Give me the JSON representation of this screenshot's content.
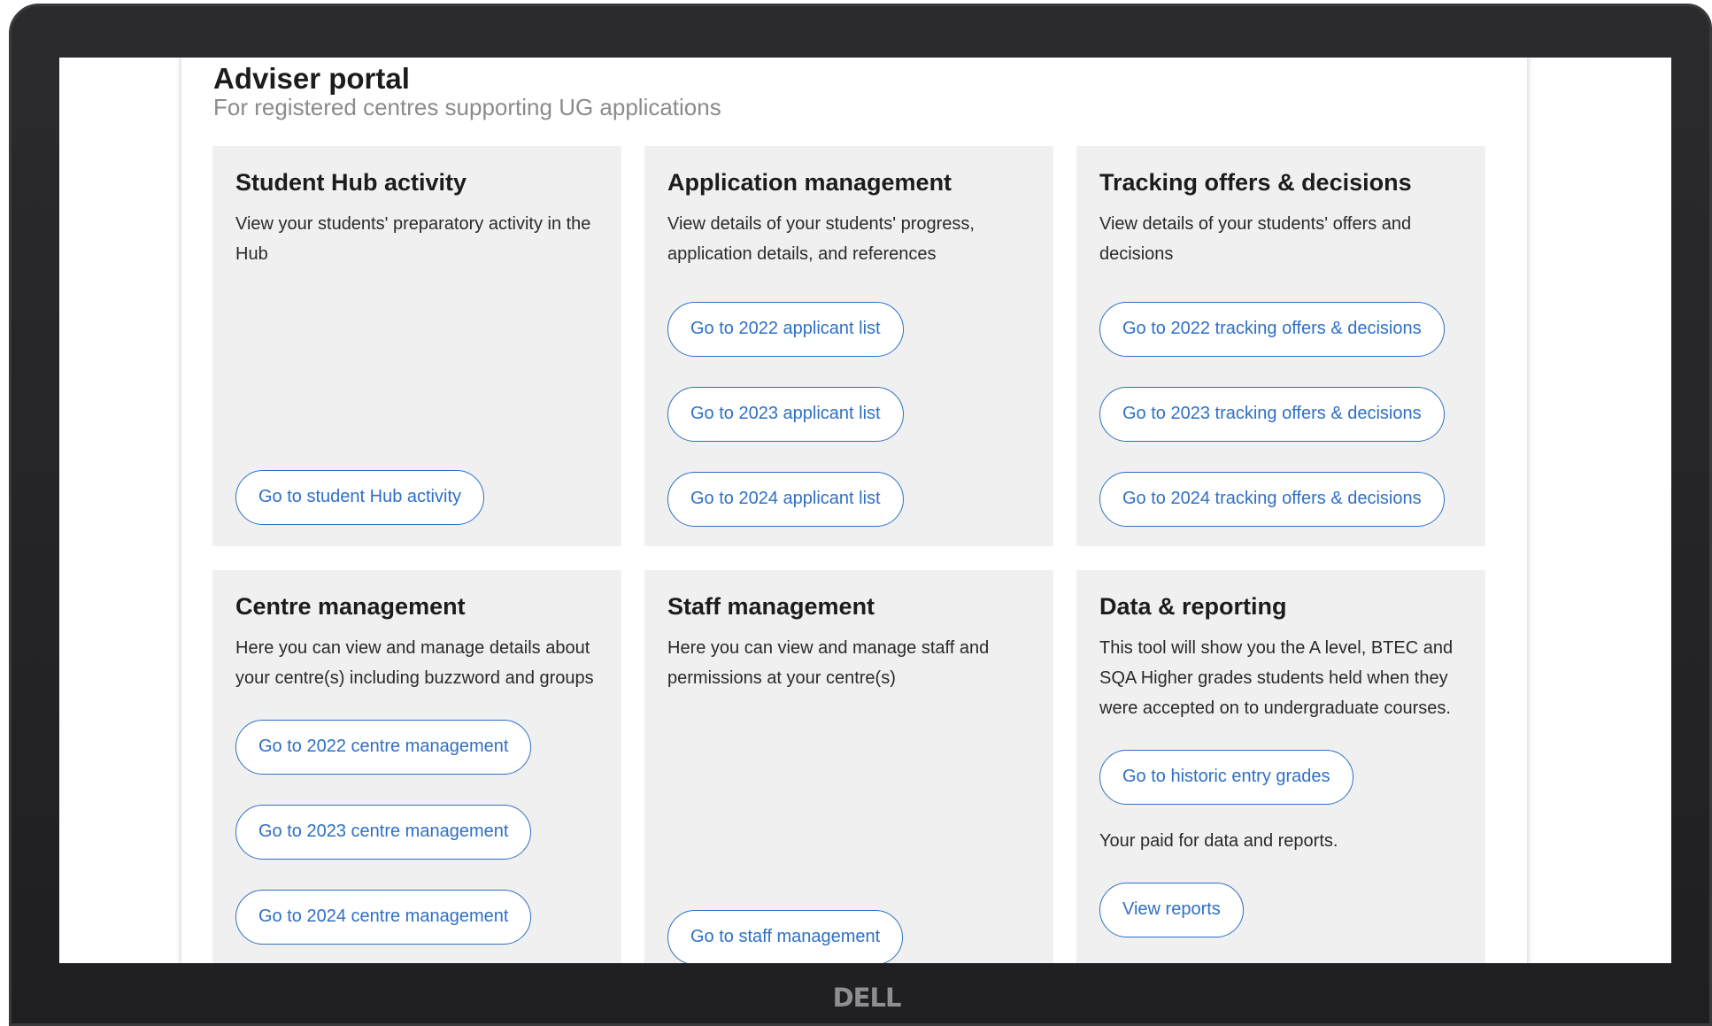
{
  "device": {
    "brand": "DELL"
  },
  "header": {
    "title": "Adviser portal",
    "subtitle": "For registered centres supporting UG applications"
  },
  "cards": [
    {
      "title": "Student Hub activity",
      "description": "View your students' preparatory activity in the Hub",
      "buttons": [
        "Go to student Hub activity"
      ]
    },
    {
      "title": "Application management",
      "description": "View details of your students' progress, application details, and references",
      "buttons": [
        "Go to 2022 applicant list",
        "Go to 2023 applicant list",
        "Go to 2024 applicant list"
      ]
    },
    {
      "title": "Tracking offers & decisions",
      "description": "View details of your students' offers and decisions",
      "buttons": [
        "Go to 2022 tracking offers & decisions",
        "Go to 2023 tracking offers & decisions",
        "Go to 2024 tracking offers & decisions"
      ]
    },
    {
      "title": "Centre management",
      "description": "Here you can view and manage details about your centre(s) including buzzword and groups",
      "buttons": [
        "Go to 2022 centre management",
        "Go to 2023 centre management",
        "Go to 2024 centre management"
      ]
    },
    {
      "title": "Staff management",
      "description": "Here you can view and manage staff and permissions at your centre(s)",
      "buttons": [
        "Go to staff management"
      ]
    },
    {
      "title": "Data & reporting",
      "description": "This tool will show you the A level, BTEC and SQA Higher grades students held when they were accepted on to undergraduate courses.",
      "buttons": [
        "Go to historic entry grades"
      ],
      "note": "Your paid for data and reports.",
      "secondary_button": "View reports"
    }
  ]
}
